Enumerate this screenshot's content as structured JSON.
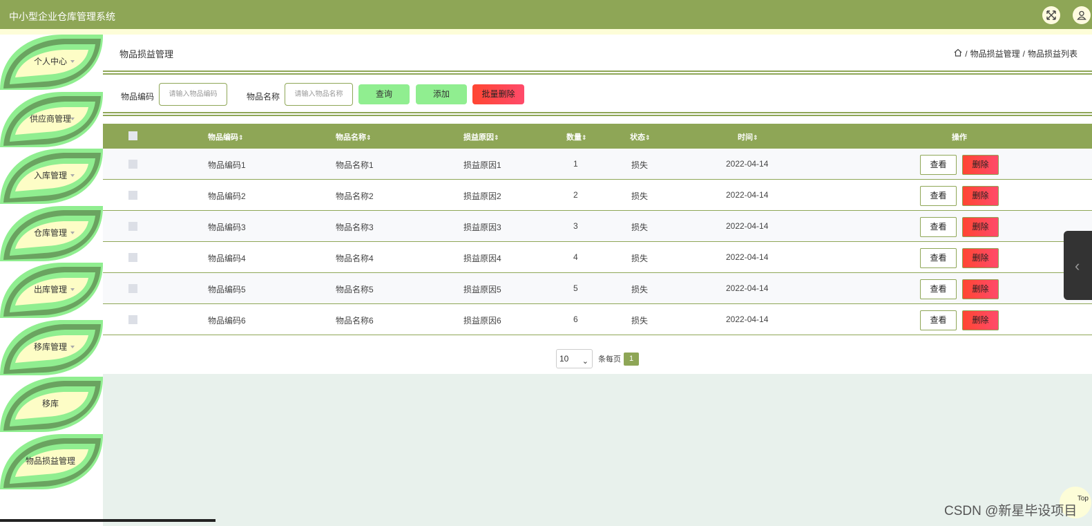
{
  "app": {
    "title": "中小型企业仓库管理系统"
  },
  "header_icons": [
    "fullscreen-icon",
    "user-icon"
  ],
  "sidebar": {
    "items": [
      {
        "label": "个人中心",
        "has_caret": true
      },
      {
        "label": "供应商管理",
        "has_caret": true
      },
      {
        "label": "入库管理",
        "has_caret": true
      },
      {
        "label": "仓库管理",
        "has_caret": true
      },
      {
        "label": "出库管理",
        "has_caret": true
      },
      {
        "label": "移库管理",
        "has_caret": true
      },
      {
        "label": "移库",
        "has_caret": false
      },
      {
        "label": "物品损益管理",
        "has_caret": true
      }
    ]
  },
  "page": {
    "title": "物品损益管理",
    "breadcrumb": [
      "/",
      "物品损益管理",
      "/",
      "物品损益列表"
    ]
  },
  "search": {
    "code_label": "物品编码",
    "code_placeholder": "请输入物品编码",
    "name_label": "物品名称",
    "name_placeholder": "请输入物品名称",
    "query_label": "查询",
    "add_label": "添加",
    "batch_delete_label": "批量删除"
  },
  "table": {
    "headers": {
      "code": "物品编码",
      "name": "物品名称",
      "reason": "损益原因",
      "qty": "数量",
      "status": "状态",
      "time": "时间",
      "ops": "操作"
    },
    "sort_glyph": "⇕",
    "view_label": "查看",
    "delete_label": "删除",
    "rows": [
      {
        "code": "物品编码1",
        "name": "物品名称1",
        "reason": "损益原因1",
        "qty": "1",
        "status": "损失",
        "time": "2022-04-14"
      },
      {
        "code": "物品编码2",
        "name": "物品名称2",
        "reason": "损益原因2",
        "qty": "2",
        "status": "损失",
        "time": "2022-04-14"
      },
      {
        "code": "物品编码3",
        "name": "物品名称3",
        "reason": "损益原因3",
        "qty": "3",
        "status": "损失",
        "time": "2022-04-14"
      },
      {
        "code": "物品编码4",
        "name": "物品名称4",
        "reason": "损益原因4",
        "qty": "4",
        "status": "损失",
        "time": "2022-04-14"
      },
      {
        "code": "物品编码5",
        "name": "物品名称5",
        "reason": "损益原因5",
        "qty": "5",
        "status": "损失",
        "time": "2022-04-14"
      },
      {
        "code": "物品编码6",
        "name": "物品名称6",
        "reason": "损益原因6",
        "qty": "6",
        "status": "损失",
        "time": "2022-04-14"
      }
    ]
  },
  "pager": {
    "page_size": "10",
    "per_page_label": "条每页",
    "current_page": "1"
  },
  "top_button": "Top",
  "watermark": "CSDN @新星毕设项目",
  "colors": {
    "header": "#8ea656",
    "accent_green": "#90ee90",
    "danger": "#ff4632",
    "leaf": "#6aa360"
  }
}
